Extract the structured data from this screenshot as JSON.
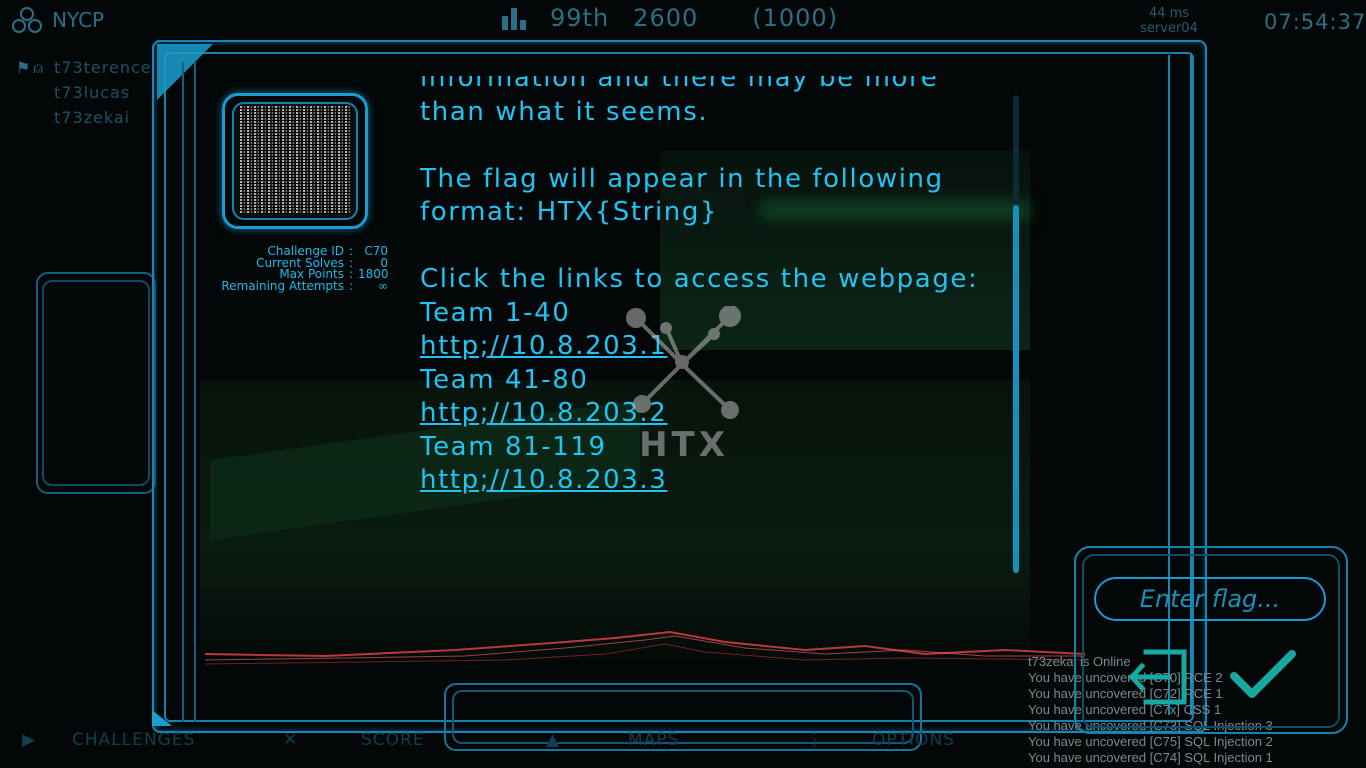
{
  "hud": {
    "team_name": "NYCP",
    "rank": "99th",
    "score": "2600",
    "score_pending": "(1000)",
    "ping": "44 ms",
    "server": "server04",
    "clock": "07:54:37"
  },
  "team_members": [
    "t73terence",
    "t73lucas",
    "t73zekai"
  ],
  "challenge": {
    "meta": [
      {
        "key": "Challenge ID",
        "value": "C70"
      },
      {
        "key": "Current Solves",
        "value": "0"
      },
      {
        "key": "Max Points",
        "value": "1800"
      },
      {
        "key": "Remaining Attempts",
        "value": "∞"
      }
    ],
    "description": {
      "cut_line": "information and there may be more",
      "line1": "than what it seems.",
      "line2": "The flag will appear in the following",
      "line3": "format: HTX{String}",
      "line4": "Click the links to access the webpage:",
      "team1": "Team 1-40",
      "link1": "http;//10.8.203.1",
      "team2": "Team 41-80",
      "link2": "http;//10.8.203.2",
      "team3": "Team 81-119",
      "link3": "http;//10.8.203.3"
    }
  },
  "watermark": "HTX",
  "nav": {
    "challenges": "CHALLENGES",
    "score": "SCORE",
    "maps": "MAPS",
    "options": "OPTIONS"
  },
  "flag_input": {
    "placeholder": "Enter flag..."
  },
  "log": [
    "t73zekai is Online",
    "You have uncovered [C70] RCE 2",
    "You have uncovered [C72] RCE 1",
    "You have uncovered [C7x] CSS 1",
    "You have uncovered [C73] SQL Injection 3",
    "You have uncovered [C75] SQL Injection 2",
    "You have uncovered [C74] SQL Injection 1"
  ],
  "colors": {
    "accent": "#1fb8e8",
    "frame": "#1a86b4",
    "submit": "#17a8a0",
    "energy": "#e8444a"
  }
}
